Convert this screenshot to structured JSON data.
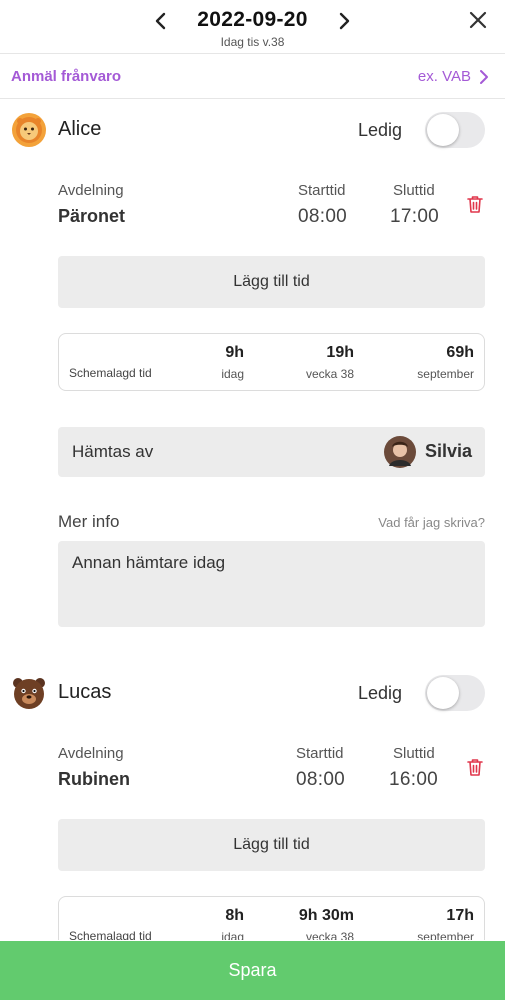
{
  "header": {
    "date": "2022-09-20",
    "subtitle": "Idag tis v.38"
  },
  "absence": {
    "label": "Anmäl frånvaro",
    "link": "ex. VAB"
  },
  "children": [
    {
      "name": "Alice",
      "avatar": "lion-avatar",
      "ledig_label": "Ledig",
      "ledig_on": false,
      "department_label": "Avdelning",
      "department": "Päronet",
      "start_label": "Starttid",
      "start": "08:00",
      "end_label": "Sluttid",
      "end": "17:00",
      "add_time_label": "Lägg till tid",
      "schedule": {
        "title": "Schemalagd tid",
        "today_value": "9h",
        "today_label": "idag",
        "week_value": "19h",
        "week_label": "vecka 38",
        "month_value": "69h",
        "month_label": "september"
      },
      "pickup_label": "Hämtas av",
      "pickup_name": "Silvia",
      "info_title": "Mer info",
      "info_help": "Vad får jag skriva?",
      "info_text": "Annan hämtare idag"
    },
    {
      "name": "Lucas",
      "avatar": "bear-avatar",
      "ledig_label": "Ledig",
      "ledig_on": false,
      "department_label": "Avdelning",
      "department": "Rubinen",
      "start_label": "Starttid",
      "start": "08:00",
      "end_label": "Sluttid",
      "end": "16:00",
      "add_time_label": "Lägg till tid",
      "schedule": {
        "title": "Schemalagd tid",
        "today_value": "8h",
        "today_label": "idag",
        "week_value": "9h 30m",
        "week_label": "vecka 38",
        "month_value": "17h",
        "month_label": "september"
      }
    }
  ],
  "save_label": "Spara",
  "colors": {
    "accent": "#a45ad6",
    "save": "#62cb6e",
    "trash": "#e0364b",
    "field_bg": "#ececec"
  }
}
